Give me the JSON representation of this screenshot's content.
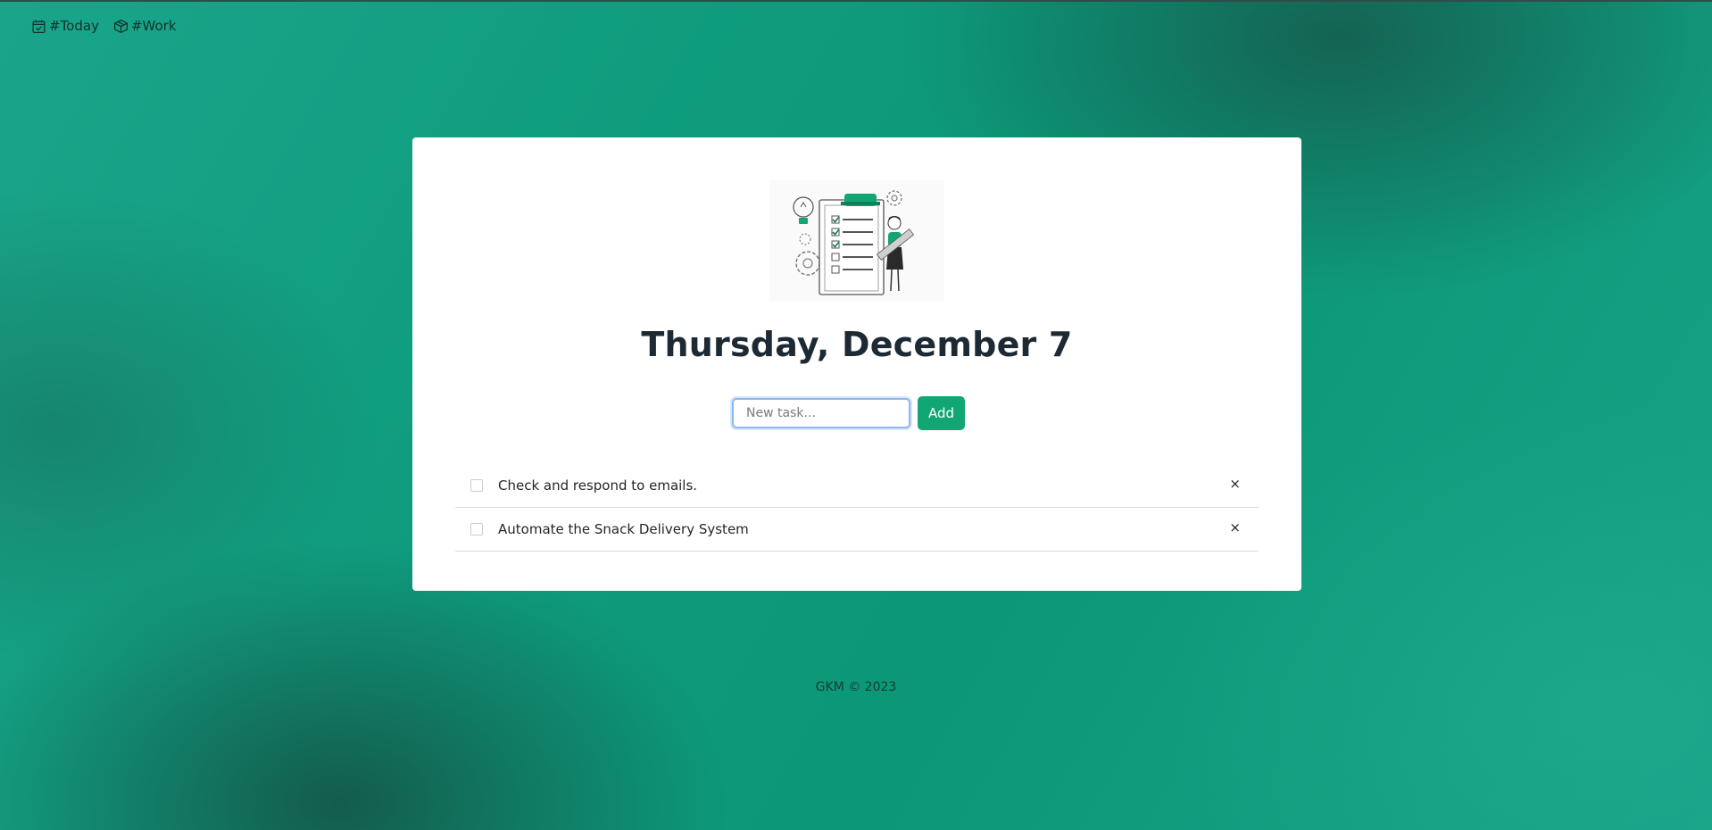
{
  "nav": {
    "items": [
      {
        "label": "#Today",
        "icon": "calendar-check-icon"
      },
      {
        "label": "#Work",
        "icon": "box-icon"
      }
    ]
  },
  "card": {
    "illustration": "checklist-woman-illustration",
    "heading": "Thursday, December 7",
    "new_task": {
      "value": "",
      "placeholder": "New task..."
    },
    "add_label": "Add",
    "tasks": [
      {
        "text": "Check and respond to emails.",
        "done": false,
        "delete_label": "×"
      },
      {
        "text": "Automate the Snack Delivery System",
        "done": false,
        "delete_label": "×"
      }
    ]
  },
  "footer": {
    "text": "GKM © 2023"
  },
  "colors": {
    "accent": "#13a675",
    "background": "#0e9c7d",
    "heading": "#1e2a33"
  }
}
